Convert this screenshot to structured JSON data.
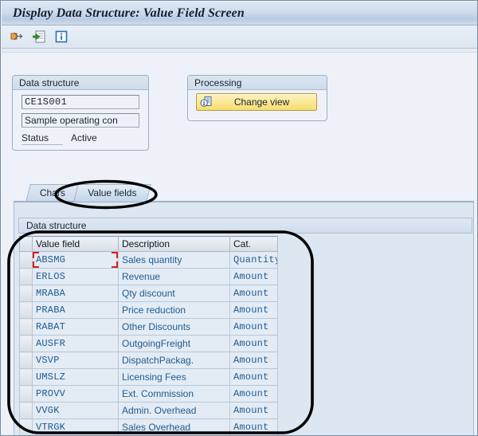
{
  "window": {
    "title": "Display Data Structure: Value Field Screen"
  },
  "toolbar": {
    "buttons": [
      {
        "name": "expand-node-icon",
        "tooltip": "Expand"
      },
      {
        "name": "choose-detail-icon",
        "tooltip": "Choose"
      },
      {
        "name": "info-icon",
        "tooltip": "Information"
      }
    ]
  },
  "data_structure_group": {
    "legend": "Data structure",
    "key_field": {
      "value": "CE1S001",
      "placeholder": ""
    },
    "description_field": {
      "value": "Sample operating con",
      "placeholder": ""
    },
    "status_label": "Status",
    "status_value": "Active"
  },
  "processing_group": {
    "legend": "Processing",
    "change_view_button": {
      "label": "Change view",
      "icon": "copy-view-icon"
    }
  },
  "tabs": [
    {
      "id": "chars",
      "label": "Chars",
      "active": false
    },
    {
      "id": "value-fields",
      "label": "Value fields",
      "active": true
    }
  ],
  "table_panel": {
    "title": "Data structure",
    "columns": [
      "Value field",
      "Description",
      "Cat."
    ],
    "rows": [
      {
        "value_field": "ABSMG",
        "description": "Sales quantity",
        "cat": "Quantity",
        "focused": true
      },
      {
        "value_field": "ERLOS",
        "description": "Revenue",
        "cat": "Amount",
        "focused": false
      },
      {
        "value_field": "MRABA",
        "description": "Qty discount",
        "cat": "Amount",
        "focused": false
      },
      {
        "value_field": "PRABA",
        "description": "Price reduction",
        "cat": "Amount",
        "focused": false
      },
      {
        "value_field": "RABAT",
        "description": "Other Discounts",
        "cat": "Amount",
        "focused": false
      },
      {
        "value_field": "AUSFR",
        "description": "OutgoingFreight",
        "cat": "Amount",
        "focused": false
      },
      {
        "value_field": "VSVP",
        "description": "DispatchPackag.",
        "cat": "Amount",
        "focused": false
      },
      {
        "value_field": "UMSLZ",
        "description": "Licensing Fees",
        "cat": "Amount",
        "focused": false
      },
      {
        "value_field": "PROVV",
        "description": "Ext. Commission",
        "cat": "Amount",
        "focused": false
      },
      {
        "value_field": "VVGK",
        "description": "Admin. Overhead",
        "cat": "Amount",
        "focused": false
      },
      {
        "value_field": "VTRGK",
        "description": "Sales Overhead",
        "cat": "Amount",
        "focused": false
      }
    ]
  },
  "annotations": [
    {
      "id": "tab-highlight",
      "shape": "ellipse",
      "color": "#000000",
      "target": "Value fields tab"
    },
    {
      "id": "table-highlight",
      "shape": "ellipse",
      "color": "#000000",
      "target": "Value field table"
    }
  ],
  "colors": {
    "title_bar": "#cfdced",
    "background": "#eef1f7",
    "grid_text": "#1f5c8f",
    "button_yellow": "#fbe896",
    "focus_marker": "#e01b1b",
    "annotation": "#000000"
  }
}
